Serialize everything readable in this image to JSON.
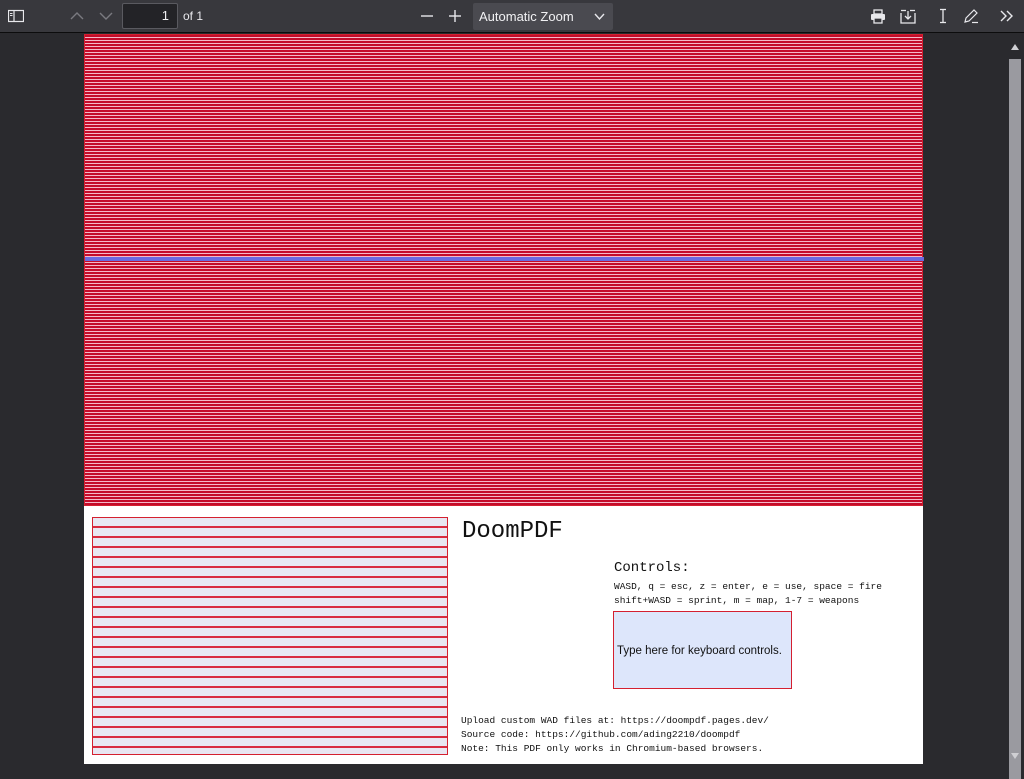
{
  "toolbar": {
    "page_number": "1",
    "page_total": "of 1",
    "zoom_label": "Automatic Zoom",
    "icons": [
      "sidebar-toggle-icon",
      "prev-page-icon",
      "next-page-icon",
      "zoom-out-icon",
      "zoom-in-icon",
      "chevron-down-icon",
      "print-icon",
      "download-icon",
      "text-cursor-icon",
      "pen-icon",
      "tools-icon"
    ]
  },
  "document": {
    "title": "DoomPDF",
    "controls_heading": "Controls:",
    "controls_lines": [
      "WASD, q = esc, z = enter, e = use, space = fire",
      "shift+WASD = sprint, m = map, 1-7 = weapons"
    ],
    "keyboard_box_text": "Type here for keyboard controls.",
    "footer_lines": [
      "Upload custom WAD files at: https://doompdf.pages.dev/",
      "Source code: https://github.com/ading2210/doompdf",
      "Note: This PDF only works in Chromium-based browsers."
    ]
  },
  "colors": {
    "toolbar_bg": "#38383d",
    "viewer_bg": "#2a2a2e",
    "screen_red": "#c40b2a",
    "screen_pink": "#f4b8c8",
    "blue_line": "#6a6ae0",
    "border_red": "#d42030",
    "kb_box_bg": "#dde6fb"
  }
}
